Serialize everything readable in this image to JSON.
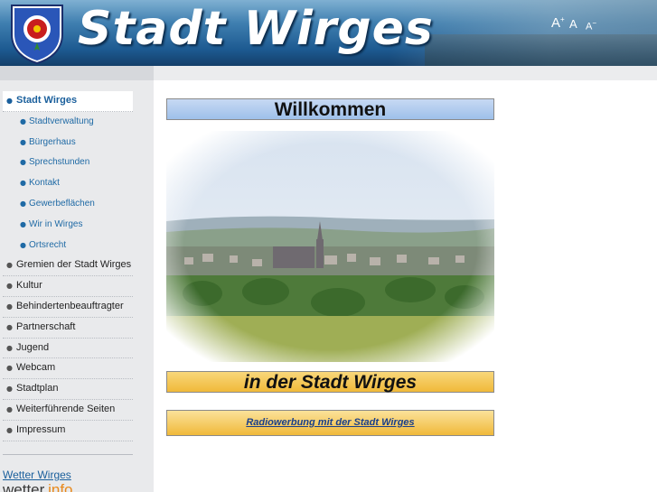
{
  "header": {
    "site_title": "Stadt Wirges",
    "font_tools": {
      "increase": "A",
      "normal": "A",
      "decrease": "A"
    }
  },
  "sidebar": {
    "items": [
      {
        "label": "Stadt Wirges",
        "level": "top",
        "active": true
      },
      {
        "label": "Stadtverwaltung",
        "level": "sub"
      },
      {
        "label": "Bürgerhaus",
        "level": "sub"
      },
      {
        "label": "Sprechstunden",
        "level": "sub"
      },
      {
        "label": "Kontakt",
        "level": "sub"
      },
      {
        "label": "Gewerbeflächen",
        "level": "sub"
      },
      {
        "label": "Wir in Wirges",
        "level": "sub"
      },
      {
        "label": "Ortsrecht",
        "level": "sub"
      },
      {
        "label": "Gremien der Stadt Wirges",
        "level": "top"
      },
      {
        "label": "Kultur",
        "level": "top"
      },
      {
        "label": "Behindertenbeauftragter",
        "level": "top"
      },
      {
        "label": "Partnerschaft",
        "level": "top"
      },
      {
        "label": "Jugend",
        "level": "top"
      },
      {
        "label": "Webcam",
        "level": "top"
      },
      {
        "label": "Stadtplan",
        "level": "top"
      },
      {
        "label": "Weiterführende Seiten",
        "level": "top"
      },
      {
        "label": "Impressum",
        "level": "top"
      }
    ],
    "weather_link": "Wetter Wirges",
    "weather_logo": {
      "part1": "wetter",
      "part2": ".info"
    }
  },
  "main": {
    "welcome_title": "Willkommen",
    "town_title": "in der Stadt Wirges",
    "radio_link": "Radiowerbung mit der Stadt Wirges"
  },
  "colors": {
    "header_blue": "#1d5a91",
    "banner_blue": "#9ec0ea",
    "banner_orange": "#f0b93a",
    "link_blue": "#1a5f9c",
    "sidebar_bg": "#e9eaec"
  }
}
